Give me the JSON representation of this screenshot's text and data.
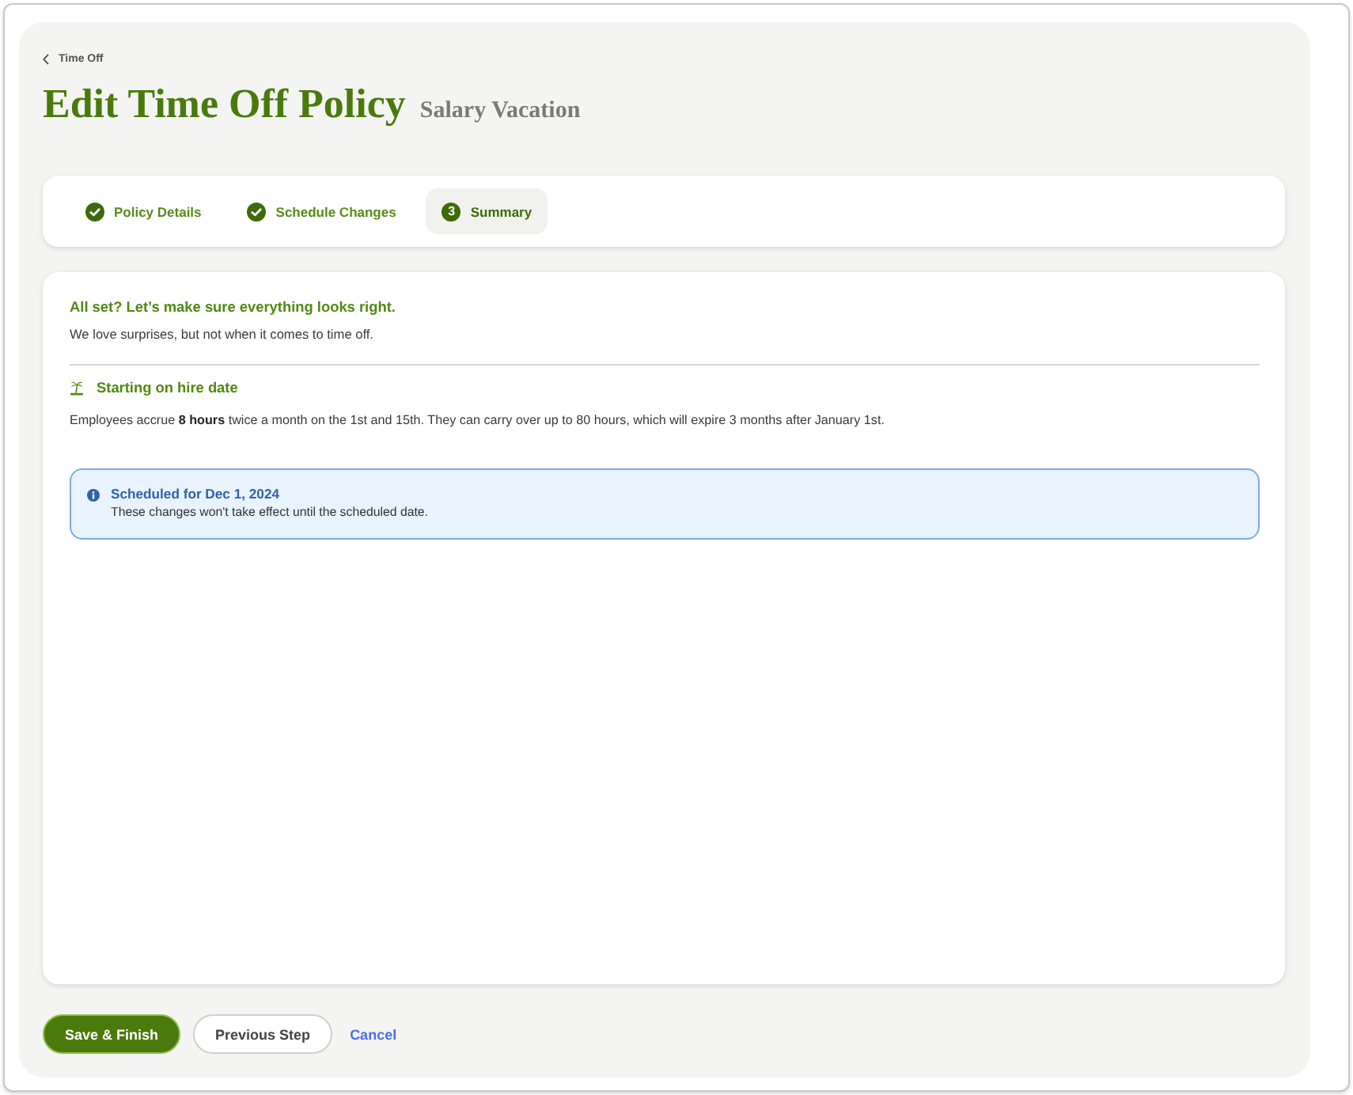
{
  "breadcrumb": {
    "label": "Time Off"
  },
  "header": {
    "title": "Edit Time Off Policy",
    "subtitle": "Salary Vacation"
  },
  "steps": [
    {
      "label": "Policy Details",
      "kind": "done",
      "selected": false
    },
    {
      "label": "Schedule Changes",
      "kind": "done",
      "selected": false
    },
    {
      "label": "Summary",
      "kind": "current",
      "number": "3",
      "selected": true
    }
  ],
  "summary": {
    "heading": "All set? Let’s make sure everything looks right.",
    "subheading": "We love surprises, but not when it comes to time off.",
    "sections": [
      {
        "title": "Starting on hire date",
        "text": "Employees accrue **8 hours** twice a month on the 1st and 15th. They can carry over up to 80 hours, which will expire 3 months after January 1st."
      }
    ]
  },
  "notice": {
    "title": "Scheduled for Dec 1, 2024",
    "text": "These changes won't take effect until the scheduled date."
  },
  "actions": [
    {
      "label": "Save & Finish",
      "kind": "primary"
    },
    {
      "label": "Previous Step",
      "kind": "secondary"
    },
    {
      "label": "Cancel",
      "kind": "link"
    }
  ]
}
